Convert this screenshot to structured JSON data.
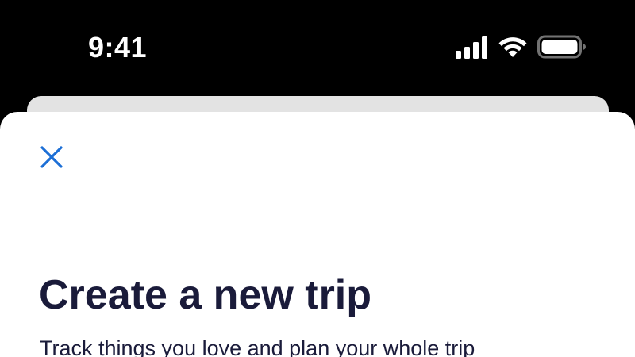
{
  "status_bar": {
    "time": "9:41",
    "icons": [
      "cellular-signal-icon",
      "wifi-icon",
      "battery-icon"
    ]
  },
  "modal": {
    "close_icon": "close-icon",
    "title": "Create a new trip",
    "subtitle": "Track things you love and plan your whole trip"
  },
  "colors": {
    "background": "#000000",
    "sheet": "#ffffff",
    "back_sheet": "#e3e3e3",
    "title_text": "#1a1b3a",
    "accent": "#1c6fd6"
  }
}
